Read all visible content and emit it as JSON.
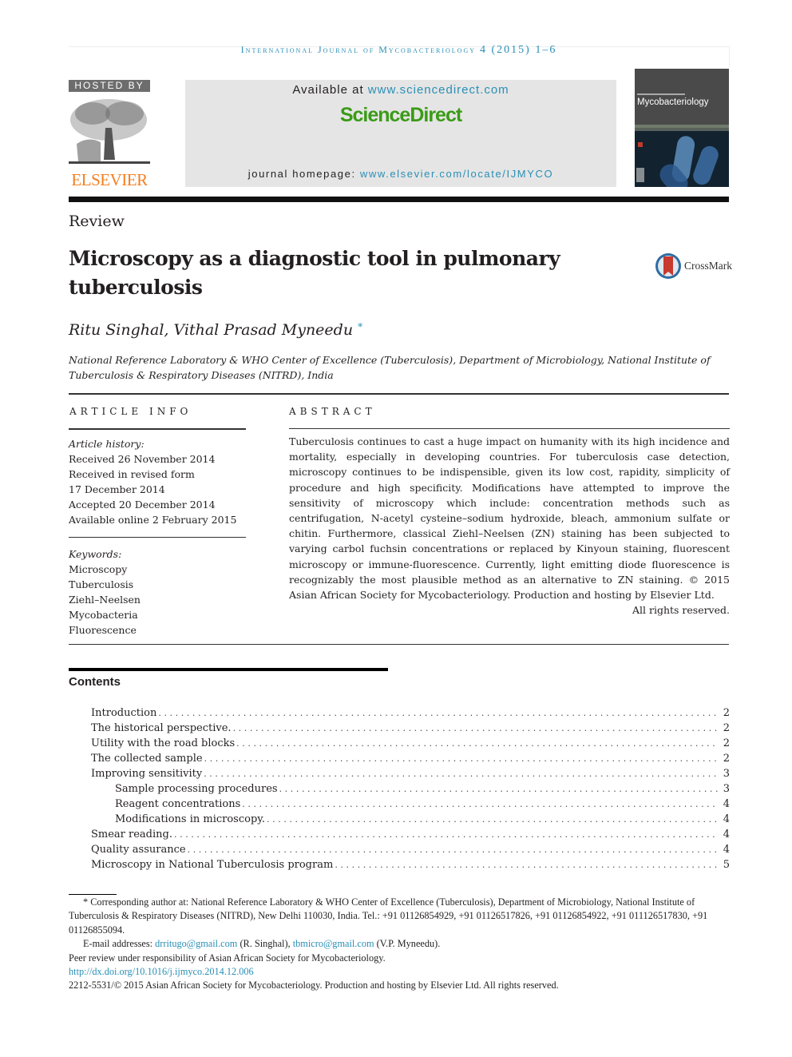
{
  "running_header": {
    "journal": "International Journal of Mycobacteriology",
    "citation": "4 (2015) 1–6"
  },
  "masthead": {
    "hosted_by": "HOSTED BY",
    "publisher": "ELSEVIER",
    "available_at_prefix": "Available at",
    "available_at_url": "www.sciencedirect.com",
    "platform_logo": "ScienceDirect",
    "homepage_prefix": "journal homepage:",
    "homepage_url": "www.elsevier.com/locate/IJMYCO",
    "cover_title": "Mycobacteriology",
    "colors": {
      "link": "#2a8fb5",
      "sciencedirect": "#3a9b16",
      "elsevier": "#f47f20"
    }
  },
  "article": {
    "type": "Review",
    "title": "Microscopy as a diagnostic tool in pulmonary tuberculosis",
    "crossmark": "CrossMark",
    "authors": "Ritu Singhal, Vithal Prasad Myneedu",
    "author_mark": "*",
    "affiliation": "National Reference Laboratory & WHO Center of Excellence (Tuberculosis), Department of Microbiology, National Institute of Tuberculosis & Respiratory Diseases (NITRD), India"
  },
  "article_info": {
    "heading": "ARTICLE INFO",
    "history_label": "Article history:",
    "history": [
      "Received 26 November 2014",
      "Received in revised form",
      "17 December 2014",
      "Accepted 20 December 2014",
      "Available online 2 February 2015"
    ],
    "keywords_label": "Keywords:",
    "keywords": [
      "Microscopy",
      "Tuberculosis",
      "Ziehl–Neelsen",
      "Mycobacteria",
      "Fluorescence"
    ]
  },
  "abstract": {
    "heading": "ABSTRACT",
    "text": "Tuberculosis continues to cast a huge impact on humanity with its high incidence and mortality, especially in developing countries. For tuberculosis case detection, microscopy continues to be indispensible, given its low cost, rapidity, simplicity of procedure and high specificity. Modifications have attempted to improve the sensitivity of microscopy which include: concentration methods such as centrifugation, N-acetyl cysteine–sodium hydroxide, bleach, ammonium sulfate or chitin. Furthermore, classical Ziehl–Neelsen (ZN) staining has been subjected to varying carbol fuchsin concentrations or replaced by Kinyoun staining, fluorescent microscopy or immune-fluorescence. Currently, light emitting diode fluorescence is recognizably the most plausible method as an alternative to ZN staining.",
    "copyright": "© 2015 Asian African Society for Mycobacteriology. Production and hosting by Elsevier Ltd.",
    "rights": "All rights reserved."
  },
  "contents": {
    "heading": "Contents",
    "items": [
      {
        "label": "Introduction",
        "page": "2",
        "level": 1
      },
      {
        "label": "The historical perspective.",
        "page": "2",
        "level": 1
      },
      {
        "label": "Utility with the road blocks",
        "page": "2",
        "level": 1
      },
      {
        "label": "The collected sample",
        "page": "2",
        "level": 1
      },
      {
        "label": "Improving sensitivity",
        "page": "3",
        "level": 1
      },
      {
        "label": "Sample processing procedures",
        "page": "3",
        "level": 2
      },
      {
        "label": "Reagent concentrations",
        "page": "4",
        "level": 2
      },
      {
        "label": "Modifications in microscopy.",
        "page": "4",
        "level": 2
      },
      {
        "label": "Smear reading.",
        "page": "4",
        "level": 1
      },
      {
        "label": "Quality assurance",
        "page": "4",
        "level": 1
      },
      {
        "label": "Microscopy in National Tuberculosis program",
        "page": "5",
        "level": 1
      }
    ]
  },
  "footnotes": {
    "corresponding": "* Corresponding author at: National Reference Laboratory & WHO Center of Excellence (Tuberculosis), Department of Microbiology, National Institute of Tuberculosis & Respiratory Diseases (NITRD), New Delhi 110030, India. Tel.: +91 01126854929, +91 01126517826, +91 01126854922, +91 011126517830, +91 01126855094.",
    "email_label": "E-mail addresses:",
    "email_1": "drritugo@gmail.com",
    "email_1_owner": "(R. Singhal),",
    "email_2": "tbmicro@gmail.com",
    "email_2_owner": "(V.P. Myneedu).",
    "peer_review": "Peer review under responsibility of Asian African Society for Mycobacteriology.",
    "doi": "http://dx.doi.org/10.1016/j.ijmyco.2014.12.006",
    "issn_copyright": "2212-5531/© 2015 Asian African Society for Mycobacteriology. Production and hosting by Elsevier Ltd. All rights reserved."
  }
}
